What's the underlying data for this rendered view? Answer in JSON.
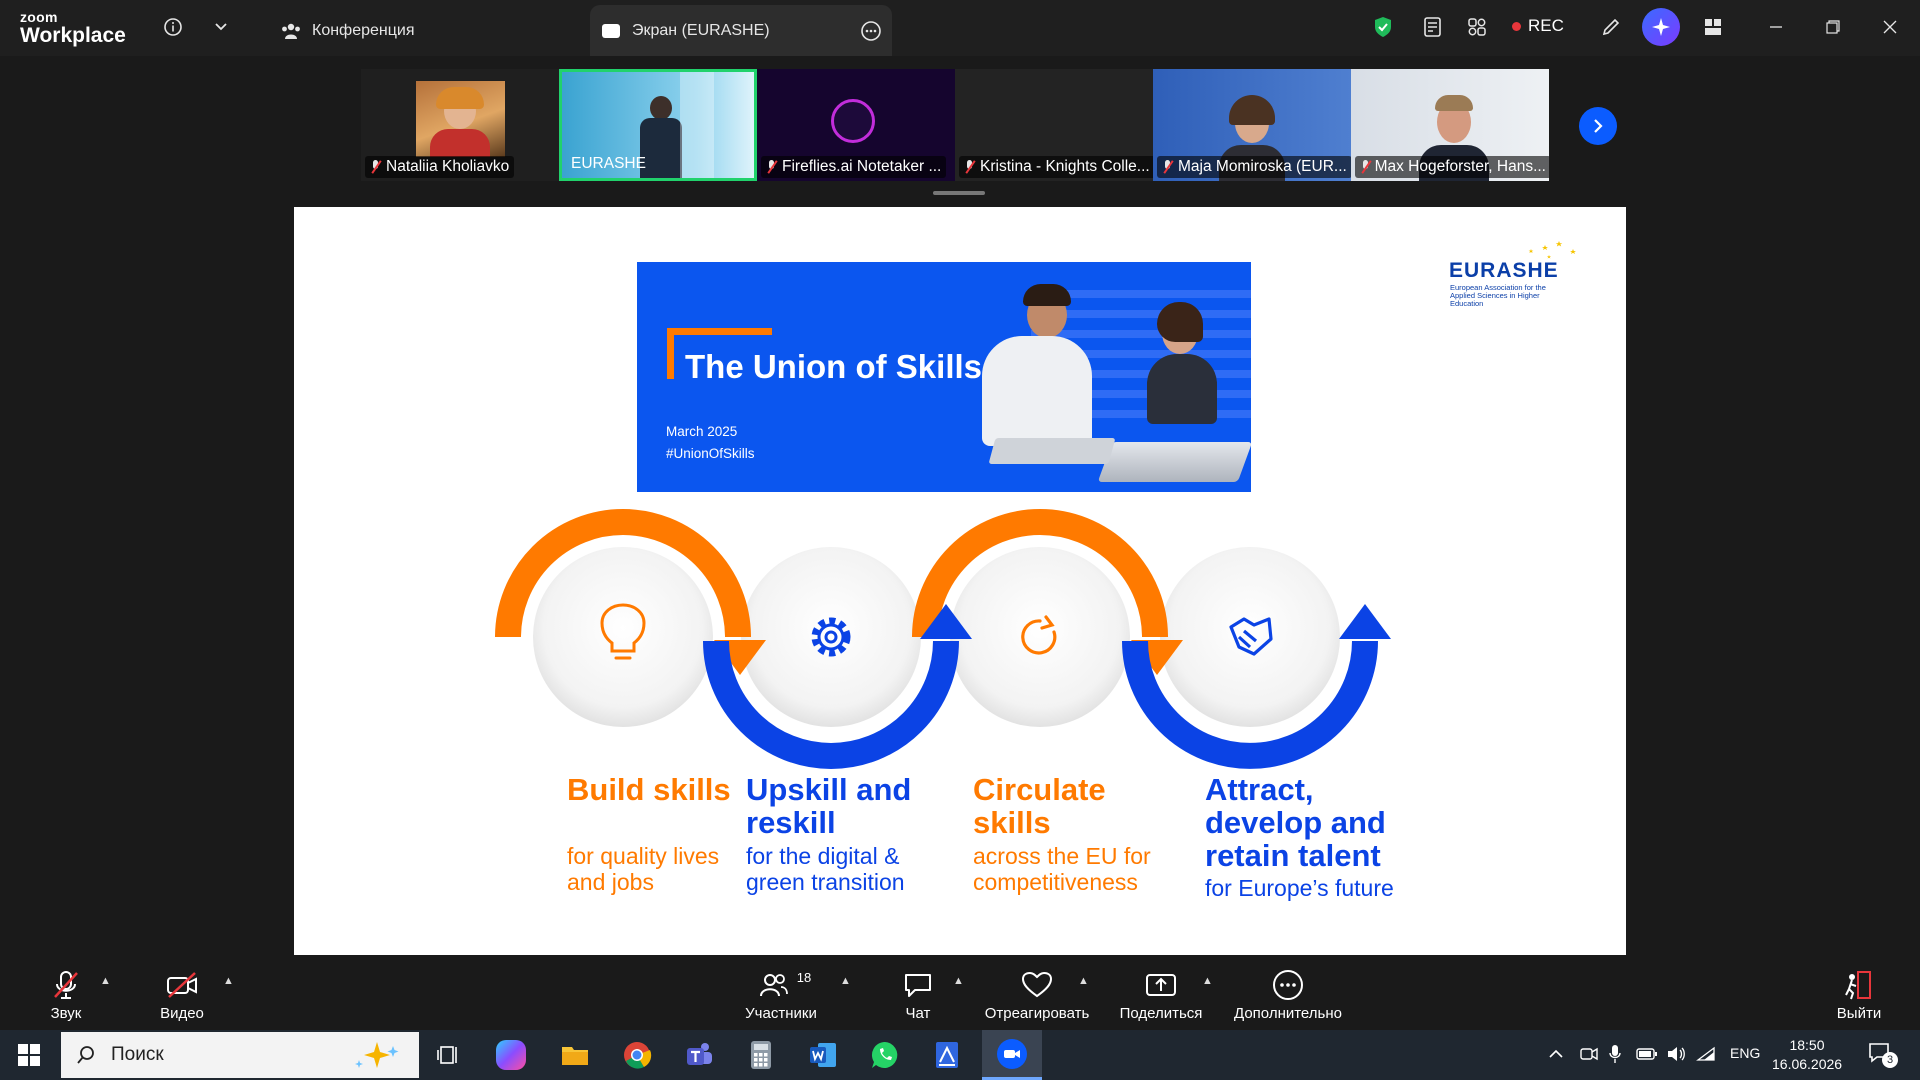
{
  "app": {
    "logo_top": "zoom",
    "logo_bottom": "Workplace"
  },
  "tabs": [
    {
      "label": "Конференция"
    },
    {
      "label": "Экран (EURASHE)"
    }
  ],
  "titlebar": {
    "rec_label": "REC"
  },
  "thumbnails": [
    {
      "name": "Nataliia Kholiavko",
      "muted": true
    },
    {
      "name": "EURASHE",
      "muted": false,
      "active_speaker": true
    },
    {
      "name": "Fireflies.ai Notetaker ...",
      "muted": true
    },
    {
      "name": "Kristina - Knights Colle...",
      "muted": true
    },
    {
      "name": "Maja Momiroska (EUR...",
      "muted": true
    },
    {
      "name": "Max Hogeforster, Hans...",
      "muted": true
    }
  ],
  "slide": {
    "banner": {
      "title": "The Union of Skills",
      "date": "March 2025",
      "hashtag": "#UnionOfSkills"
    },
    "logo": {
      "name": "EURASHE",
      "subtitle": "European Association for the Applied Sciences in Higher Education"
    },
    "steps": [
      {
        "title": "Build skills",
        "subtitle": "for quality lives and jobs",
        "icon": "lightbulb-icon",
        "color": "#ff7a00"
      },
      {
        "title": "Upskill and reskill",
        "subtitle": "for the digital & green transition",
        "icon": "gear-icon",
        "color": "#0b43e5"
      },
      {
        "title": "Circulate skills",
        "subtitle": "across the EU for competitiveness",
        "icon": "refresh-icon",
        "color": "#ff7a00"
      },
      {
        "title": "Attract, develop and retain talent",
        "subtitle": "for Europe’s future",
        "icon": "handshake-icon",
        "color": "#0b43e5"
      }
    ]
  },
  "controls": {
    "audio": "Звук",
    "video": "Видео",
    "participants": "Участники",
    "participants_count": "18",
    "chat": "Чат",
    "react": "Отреагировать",
    "share": "Поделиться",
    "more": "Дополнительно",
    "leave": "Выйти"
  },
  "taskbar": {
    "search_placeholder": "Поиск",
    "language": "ENG",
    "time": "18:50",
    "date": "16.06.2026",
    "notifications": "3"
  }
}
